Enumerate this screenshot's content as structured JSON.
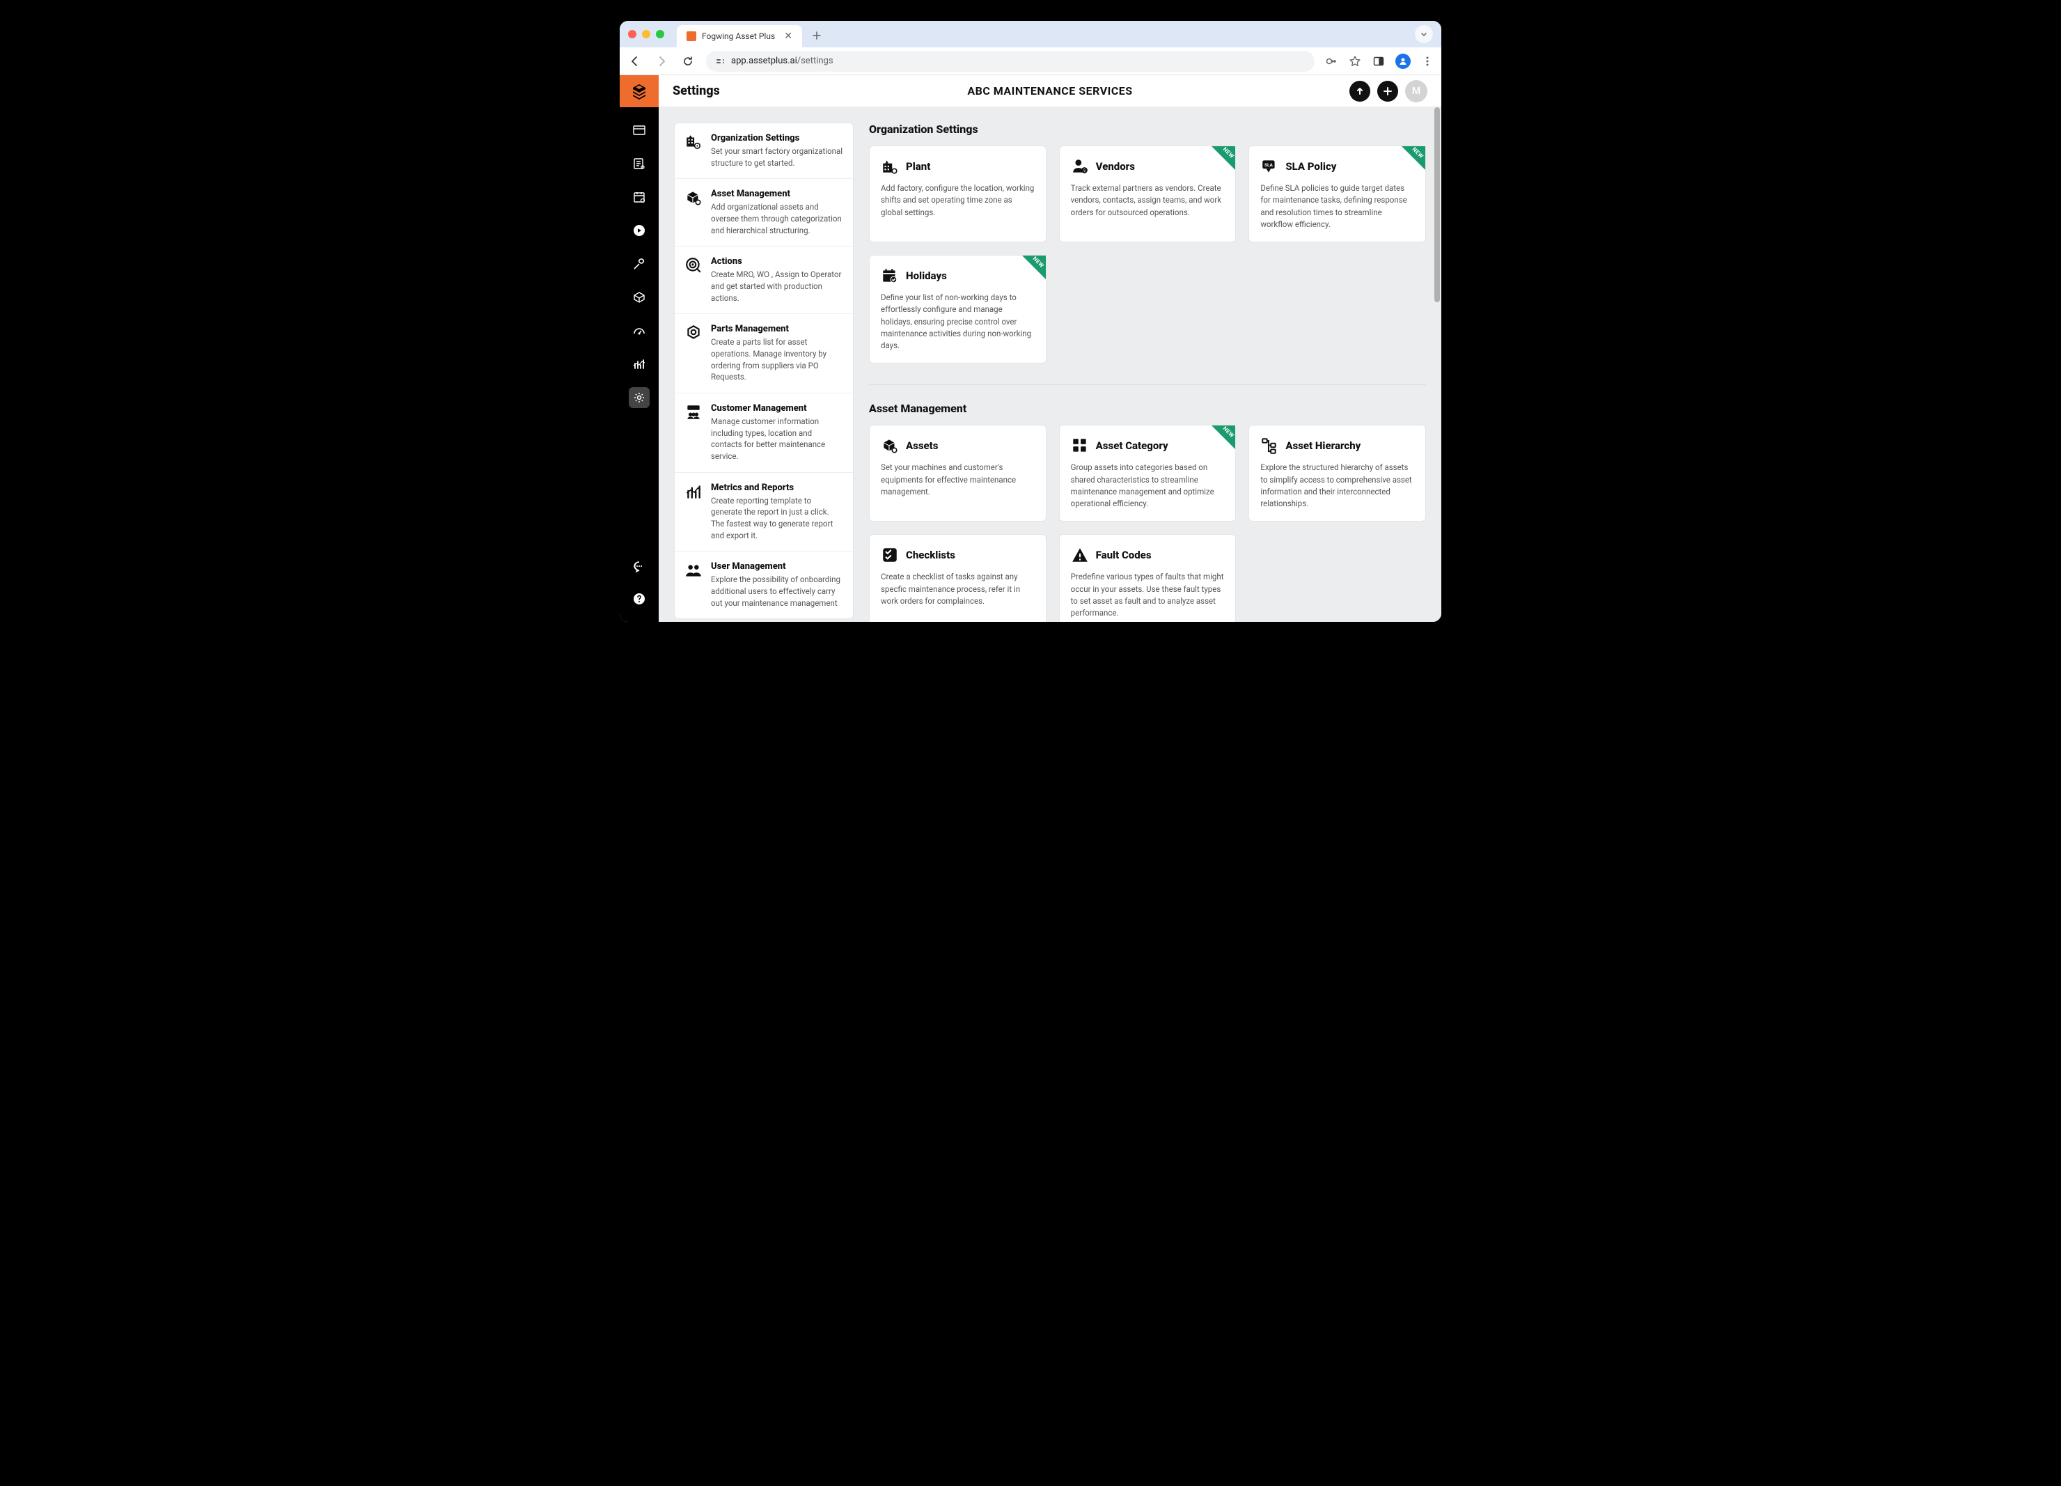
{
  "browser": {
    "tab_title": "Fogwing Asset Plus",
    "url_display": "app.assetplus.ai/settings",
    "url_domain": "app.assetplus.ai",
    "url_path": "/settings"
  },
  "header": {
    "page_title": "Settings",
    "company": "ABC MAINTENANCE SERVICES",
    "avatar_initial": "M"
  },
  "nav": [
    {
      "title": "Organization Settings",
      "desc": "Set your smart factory organizational structure to get started."
    },
    {
      "title": "Asset Management",
      "desc": "Add organizational assets and oversee them through categorization and hierarchical structuring."
    },
    {
      "title": "Actions",
      "desc": "Create MRO, WO , Assign to Operator and get started with production actions."
    },
    {
      "title": "Parts Management",
      "desc": "Create a parts list for asset operations. Manage inventory by ordering from suppliers via PO Requests."
    },
    {
      "title": "Customer Management",
      "desc": "Manage customer information including types, location and contacts for better maintenance service."
    },
    {
      "title": "Metrics and Reports",
      "desc": "Create reporting template to generate the report in just a click. The fastest way to generate report and export it."
    },
    {
      "title": "User Management",
      "desc": "Explore the possibility of onboarding additional users to effectively carry out your maintenance management"
    }
  ],
  "sections": [
    {
      "title": "Organization Settings",
      "cards": [
        {
          "title": "Plant",
          "desc": "Add factory, configure the location, working shifts and set operating time zone as global settings.",
          "new": false
        },
        {
          "title": "Vendors",
          "desc": "Track external partners as vendors. Create vendors, contacts, assign teams, and work orders for outsourced operations.",
          "new": true
        },
        {
          "title": "SLA Policy",
          "desc": "Define SLA policies to guide target dates for maintenance tasks, defining response and resolution times to streamline workflow efficiency.",
          "new": true
        },
        {
          "title": "Holidays",
          "desc": "Define your list of non-working days to effortlessly configure and manage holidays, ensuring precise control over maintenance activities during non-working days.",
          "new": true
        }
      ]
    },
    {
      "title": "Asset Management",
      "cards": [
        {
          "title": "Assets",
          "desc": "Set your machines and customer's equipments for effective maintenance management.",
          "new": false
        },
        {
          "title": "Asset Category",
          "desc": "Group assets into categories based on shared characteristics to streamline maintenance management and optimize operational efficiency.",
          "new": true
        },
        {
          "title": "Asset Hierarchy",
          "desc": "Explore the structured hierarchy of assets to simplify access to comprehensive asset information and their interconnected relationships.",
          "new": false
        },
        {
          "title": "Checklists",
          "desc": "Create a checklist of tasks against any specfic maintenance process, refer it in work orders for complainces.",
          "new": false
        },
        {
          "title": "Fault Codes",
          "desc": "Predefine various types of faults that might occur in your assets. Use these fault types to set asset as fault and to analyze asset performance.",
          "new": false
        }
      ]
    }
  ],
  "labels": {
    "new_badge": "NEW"
  }
}
